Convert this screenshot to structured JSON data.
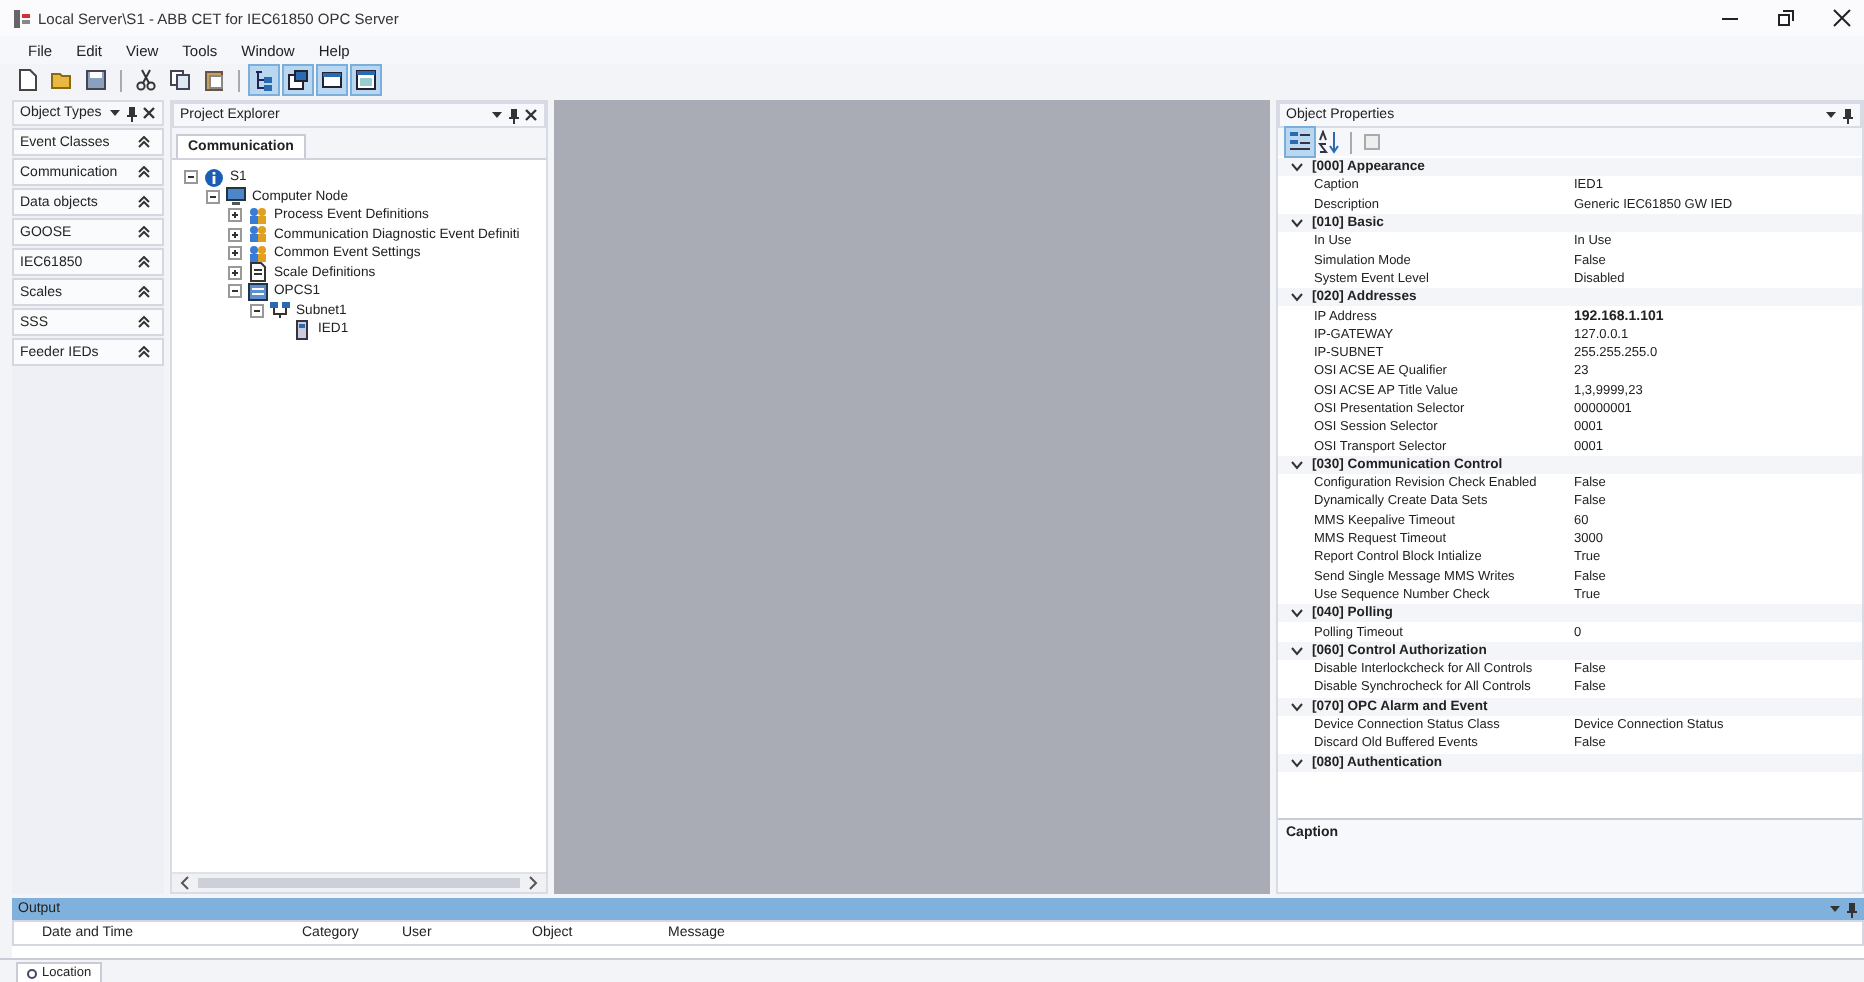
{
  "window": {
    "title": "Local Server\\S1 - ABB CET for IEC61850 OPC Server"
  },
  "menu": [
    "File",
    "Edit",
    "View",
    "Tools",
    "Window",
    "Help"
  ],
  "toolbar": [
    {
      "on": false
    },
    {
      "on": false
    },
    {
      "on": false
    },
    {
      "on": false
    },
    {
      "on": false
    },
    {
      "on": false
    },
    {
      "on": true
    },
    {
      "on": true
    },
    {
      "on": true
    },
    {
      "on": true
    }
  ],
  "object_types": {
    "title": "Object Types",
    "items": [
      "Event Classes",
      "Communication",
      "Data objects",
      "GOOSE",
      "IEC61850",
      "Scales",
      "SSS",
      "Feeder IEDs"
    ]
  },
  "project_explorer": {
    "title": "Project Explorer",
    "tabs": [
      {
        "label": "Communication",
        "selected": true
      }
    ],
    "tree": [
      {
        "label": "S1",
        "kind": "server",
        "expanded": true,
        "children": [
          {
            "label": "Computer Node",
            "kind": "computer",
            "expanded": true,
            "children": [
              {
                "label": "Process Event Definitions",
                "kind": "events",
                "expanded": false
              },
              {
                "label": "Communication Diagnostic Event Definiti",
                "kind": "events",
                "expanded": false
              },
              {
                "label": "Common Event Settings",
                "kind": "events",
                "expanded": false
              },
              {
                "label": "Scale Definitions",
                "kind": "scale",
                "expanded": false
              },
              {
                "label": "OPCS1",
                "kind": "opc",
                "expanded": true,
                "children": [
                  {
                    "label": "Subnet1",
                    "kind": "subnet",
                    "expanded": true,
                    "children": [
                      {
                        "label": "IED1",
                        "kind": "ied"
                      }
                    ]
                  }
                ]
              }
            ]
          }
        ]
      }
    ]
  },
  "object_properties": {
    "title": "Object Properties",
    "sort_buttons": [
      {
        "selected": true
      },
      {
        "selected": false
      }
    ],
    "groups": [
      {
        "name": "[000] Appearance",
        "expanded": true,
        "properties": [
          {
            "name": "Caption",
            "value": "IED1",
            "modified": false
          },
          {
            "name": "Description",
            "value": "Generic IEC61850 GW IED",
            "modified": false
          }
        ]
      },
      {
        "name": "[010] Basic",
        "expanded": true,
        "properties": [
          {
            "name": "In Use",
            "value": "In Use",
            "modified": false
          },
          {
            "name": "Simulation Mode",
            "value": "False",
            "modified": false
          },
          {
            "name": "System Event Level",
            "value": "Disabled",
            "modified": false
          }
        ]
      },
      {
        "name": "[020] Addresses",
        "expanded": true,
        "properties": [
          {
            "name": "IP Address",
            "value": "192.168.1.101",
            "modified": true
          },
          {
            "name": "IP-GATEWAY",
            "value": "127.0.0.1",
            "modified": false
          },
          {
            "name": "IP-SUBNET",
            "value": "255.255.255.0",
            "modified": false
          },
          {
            "name": "OSI ACSE AE Qualifier",
            "value": "23",
            "modified": false
          },
          {
            "name": "OSI ACSE AP Title Value",
            "value": "1,3,9999,23",
            "modified": false
          },
          {
            "name": "OSI Presentation Selector",
            "value": "00000001",
            "modified": false
          },
          {
            "name": "OSI Session Selector",
            "value": "0001",
            "modified": false
          },
          {
            "name": "OSI Transport Selector",
            "value": "0001",
            "modified": false
          }
        ]
      },
      {
        "name": "[030] Communication Control",
        "expanded": true,
        "properties": [
          {
            "name": "Configuration Revision Check Enabled",
            "value": "False",
            "modified": false
          },
          {
            "name": "Dynamically Create Data Sets",
            "value": "False",
            "modified": false
          },
          {
            "name": "MMS Keepalive Timeout",
            "value": "60",
            "modified": false
          },
          {
            "name": "MMS Request Timeout",
            "value": "3000",
            "modified": false
          },
          {
            "name": "Report Control Block Intialize",
            "value": "True",
            "modified": false
          },
          {
            "name": "Send Single Message MMS Writes",
            "value": "False",
            "modified": false
          },
          {
            "name": "Use Sequence Number Check",
            "value": "True",
            "modified": false
          }
        ]
      },
      {
        "name": "[040] Polling",
        "expanded": true,
        "properties": [
          {
            "name": "Polling Timeout",
            "value": "0",
            "modified": false
          }
        ]
      },
      {
        "name": "[060] Control Authorization",
        "expanded": true,
        "properties": [
          {
            "name": "Disable Interlockcheck for All Controls",
            "value": "False",
            "modified": false
          },
          {
            "name": "Disable Synchrocheck for All Controls",
            "value": "False",
            "modified": false
          }
        ]
      },
      {
        "name": "[070] OPC Alarm and Event",
        "expanded": true,
        "properties": [
          {
            "name": "Device Connection Status Class",
            "value": "Device Connection Status",
            "modified": false
          },
          {
            "name": "Discard Old Buffered Events",
            "value": "False",
            "modified": false
          }
        ]
      },
      {
        "name": "[080] Authentication",
        "expanded": true
      }
    ],
    "description": {
      "title": "Caption"
    }
  },
  "output": {
    "title": "Output",
    "columns": [
      "Date and Time",
      "Category",
      "User",
      "Object",
      "Message"
    ]
  },
  "status_bar": {
    "tabs": [
      {
        "label": "Location"
      }
    ]
  }
}
